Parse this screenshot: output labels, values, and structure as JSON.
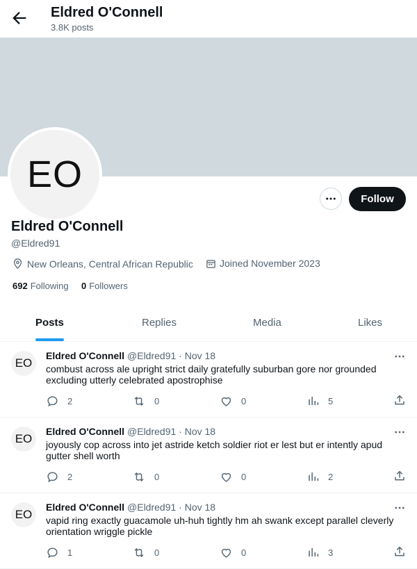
{
  "header": {
    "name": "Eldred O'Connell",
    "post_count": "3.8K posts"
  },
  "profile": {
    "initials": "EO",
    "name": "Eldred O'Connell",
    "handle": "@Eldred91",
    "location": "New Orleans, Central African Republic",
    "joined": "Joined November 2023",
    "following_count": "692",
    "following_label": "Following",
    "followers_count": "0",
    "followers_label": "Followers",
    "follow_label": "Follow",
    "banner_color": "#cfd9de"
  },
  "tabs": [
    {
      "label": "Posts",
      "active": true
    },
    {
      "label": "Replies"
    },
    {
      "label": "Media"
    },
    {
      "label": "Likes"
    }
  ],
  "posts": [
    {
      "initials": "EO",
      "name": "Eldred O'Connell",
      "meta": "@Eldred91 · Nov 18",
      "text": "combust across ale upright strict daily gratefully suburban gore nor grounded excluding utterly celebrated apostrophise",
      "replies": "2",
      "reposts": "0",
      "likes": "0",
      "views": "5"
    },
    {
      "initials": "EO",
      "name": "Eldred O'Connell",
      "meta": "@Eldred91 · Nov 18",
      "text": "joyously cop across into jet astride ketch soldier riot er lest but er intently apud gutter shell worth",
      "replies": "2",
      "reposts": "0",
      "likes": "0",
      "views": "2"
    },
    {
      "initials": "EO",
      "name": "Eldred O'Connell",
      "meta": "@Eldred91 · Nov 18",
      "text": "vapid ring exactly guacamole uh-huh tightly hm ah swank except parallel cleverly orientation wriggle pickle",
      "replies": "1",
      "reposts": "0",
      "likes": "0",
      "views": "3"
    }
  ],
  "icons": {
    "back": "arrow-left-icon",
    "more": "more-horizontal-icon",
    "location": "location-pin-icon",
    "calendar": "calendar-icon",
    "reply": "reply-icon",
    "repost": "repost-icon",
    "like": "heart-icon",
    "views": "views-icon",
    "share": "share-icon"
  }
}
